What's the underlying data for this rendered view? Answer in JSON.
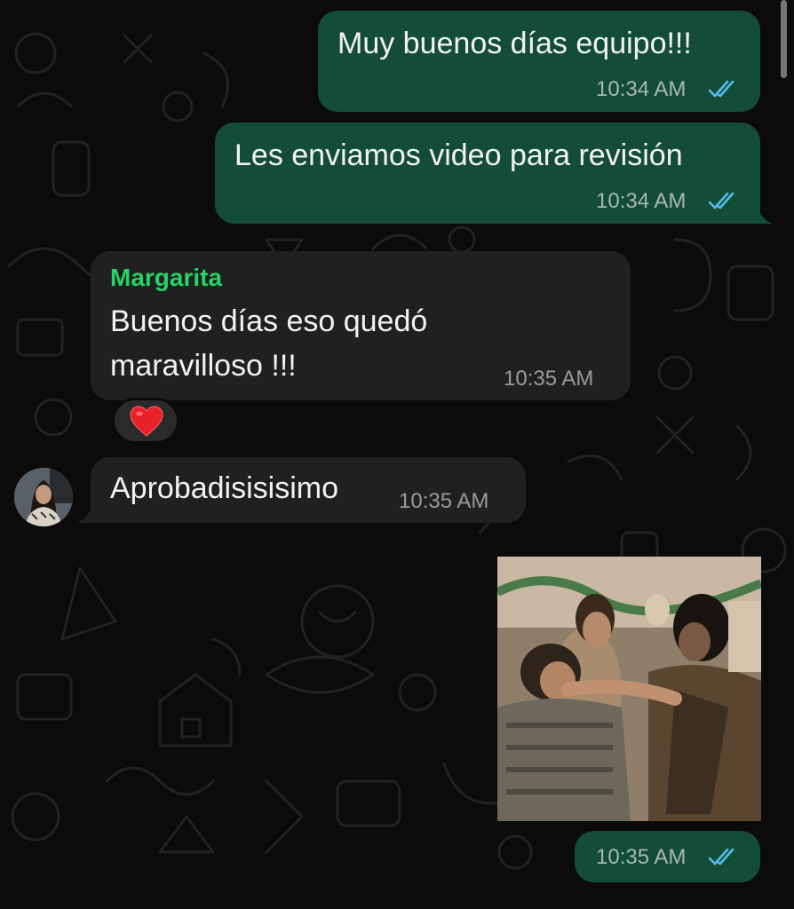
{
  "messages": [
    {
      "direction": "outgoing",
      "text": "Muy buenos días equipo!!!",
      "time": "10:34 AM",
      "status": "read"
    },
    {
      "direction": "outgoing",
      "text": "Les enviamos video para revisión",
      "time": "10:34 AM",
      "status": "read"
    },
    {
      "direction": "incoming",
      "sender": "Margarita",
      "text_lines": [
        "Buenos días eso quedó",
        "maravilloso !!!"
      ],
      "time": "10:35 AM",
      "reaction": "❤️"
    },
    {
      "direction": "incoming",
      "text": "Aprobadisisisimo",
      "time": "10:35 AM"
    },
    {
      "direction": "outgoing",
      "type": "video",
      "time": "10:35 AM",
      "status": "read"
    }
  ],
  "icons": {
    "read_receipt": "double-check-icon",
    "reaction": "heart-icon"
  },
  "colors": {
    "background": "#0b0b0b",
    "outgoing": "#144d37",
    "incoming": "#202020",
    "sender": "#25d366",
    "read_receipt": "#53bdeb"
  }
}
